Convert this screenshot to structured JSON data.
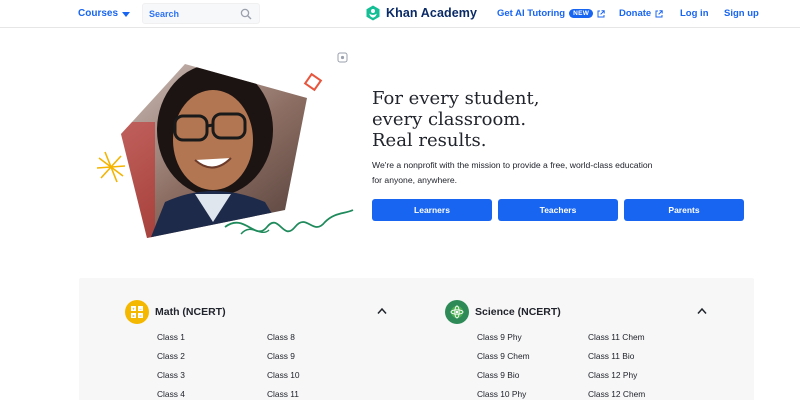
{
  "header": {
    "courses_label": "Courses",
    "search_placeholder": "Search",
    "logo_text": "Khan Academy",
    "tutoring_label": "Get AI Tutoring",
    "new_badge": "NEW",
    "donate_label": "Donate",
    "login_label": "Log in",
    "signup_label": "Sign up"
  },
  "hero": {
    "headline_1": "For every student,",
    "headline_2": "every classroom.",
    "headline_3": "Real results.",
    "subtext_1": "We're a nonprofit with the mission to provide a free, world-class education",
    "subtext_2": "for anyone, anywhere.",
    "buttons": {
      "learners": "Learners",
      "teachers": "Teachers",
      "parents": "Parents"
    }
  },
  "subjects": {
    "math": {
      "title": "Math (NCERT)",
      "col1": [
        "Class 1",
        "Class 2",
        "Class 3",
        "Class 4"
      ],
      "col2": [
        "Class 8",
        "Class 9",
        "Class 10",
        "Class 11"
      ]
    },
    "science": {
      "title": "Science (NCERT)",
      "col1": [
        "Class 9 Phy",
        "Class 9 Chem",
        "Class 9 Bio",
        "Class 10 Phy"
      ],
      "col2": [
        "Class 11 Chem",
        "Class 11 Bio",
        "Class 12 Phy",
        "Class 12 Chem"
      ]
    }
  },
  "colors": {
    "primary": "#1865f2",
    "logo_green": "#14bf96",
    "math_icon": "#f5b800",
    "science_icon": "#2e8b57"
  },
  "icons": [
    "chevron-down-icon",
    "search-icon",
    "khan-logo-icon",
    "external-link-icon",
    "chevron-up-icon",
    "math-subject-icon",
    "science-subject-icon"
  ]
}
